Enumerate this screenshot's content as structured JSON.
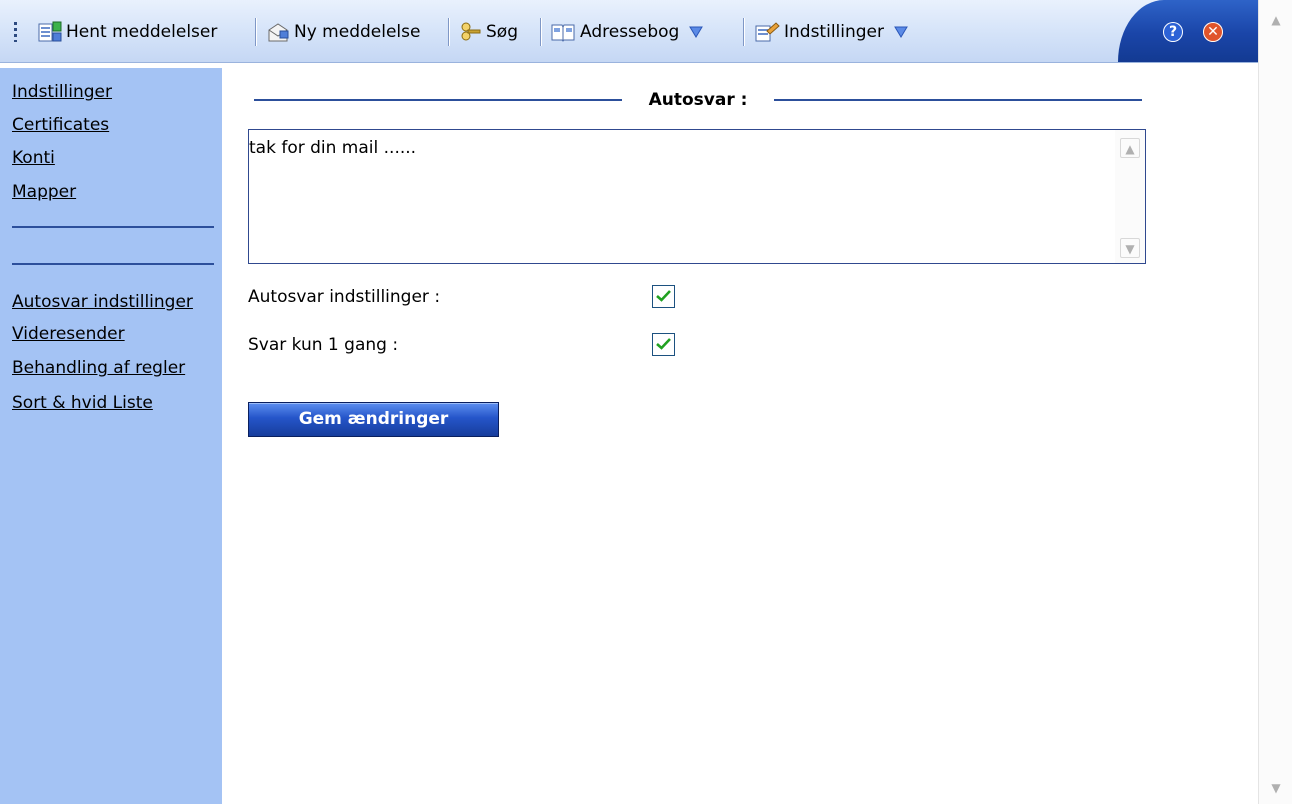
{
  "toolbar": {
    "get_messages": "Hent meddelelser",
    "new_message": "Ny meddelelse",
    "search": "Søg",
    "address_book": "Adressebog",
    "settings": "Indstillinger",
    "icons": [
      "inbox-icon",
      "new-message-icon",
      "search-icon",
      "address-book-icon",
      "settings-icon",
      "help-icon",
      "close-icon"
    ]
  },
  "sidebar": {
    "items_top": [
      "Indstillinger",
      "Certificates",
      "Konti",
      "Mapper"
    ],
    "items_bottom": [
      "Autosvar indstillinger",
      "Videresender",
      "Behandling af regler",
      "Sort & hvid Liste"
    ]
  },
  "main": {
    "section_title": "Autosvar :",
    "reply_text": "tak for din mail ......",
    "autoreply_label": "Autosvar indstillinger :",
    "autoreply_checked": true,
    "reply_once_label": "Svar kun 1 gang :",
    "reply_once_checked": true,
    "save_label": "Gem ændringer"
  },
  "colors": {
    "toolbar_bg": "#d6e4f9",
    "toolbar_dark": "#1a45a8",
    "sidebar_bg": "#a4c3f4",
    "rule": "#2c4f9b",
    "button_bg": "#2555c9",
    "check": "#21a121"
  }
}
